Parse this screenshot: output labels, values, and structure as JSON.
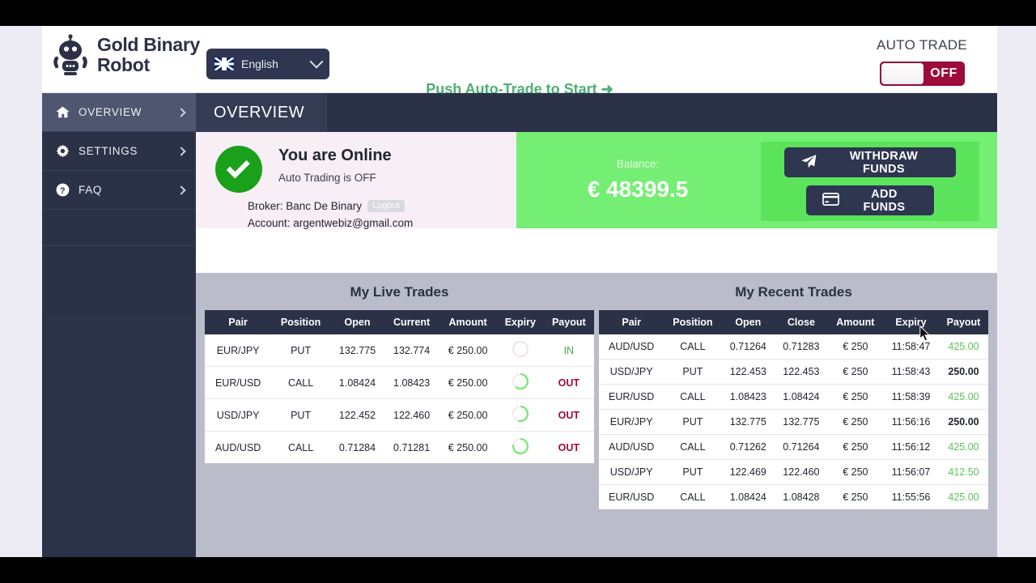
{
  "header": {
    "brand_name": "Gold Binary\nRobot",
    "logo_icon": "robot-icon",
    "language": {
      "flag_icon": "uk-flag-icon",
      "label": "English",
      "chevron_icon": "chevron-down-icon"
    },
    "cta": "Push Auto-Trade to Start ➜",
    "auto_trade": {
      "label": "AUTO TRADE",
      "state": "OFF"
    }
  },
  "sidebar": {
    "items": [
      {
        "label": "OVERVIEW",
        "icon": "home-icon",
        "arrow_icon": "chevron-right-icon",
        "active": true
      },
      {
        "label": "SETTINGS",
        "icon": "gear-icon",
        "arrow_icon": "chevron-right-icon",
        "active": false
      },
      {
        "label": "FAQ",
        "icon": "question-icon",
        "arrow_icon": "chevron-right-icon",
        "active": false
      }
    ]
  },
  "main": {
    "page_title": "OVERVIEW",
    "status_card": {
      "check_icon": "check-circle-icon",
      "title": "You are Online",
      "subtitle": "Auto Trading is OFF",
      "broker_label": "Broker: Banc De Binary",
      "logout_label": "Logout",
      "account_label": "Account: argentwebiz@gmail.com"
    },
    "balance_card": {
      "balance_label": "Balance:",
      "balance_value": "€ 48399.5",
      "withdraw_label": "WITHDRAW FUNDS",
      "withdraw_icon": "paper-plane-icon",
      "add_funds_label": "ADD FUNDS",
      "add_funds_icon": "credit-card-icon"
    }
  },
  "live_trades": {
    "title": "My Live Trades",
    "columns": [
      "Pair",
      "Position",
      "Open",
      "Current",
      "Amount",
      "Expiry",
      "Payout"
    ],
    "rows": [
      {
        "pair": "EUR/JPY",
        "position": "PUT",
        "open": "132.775",
        "current": "132.774",
        "amount": "€ 250.00",
        "progress": 0,
        "payout": "IN",
        "payout_kind": "in"
      },
      {
        "pair": "EUR/USD",
        "position": "CALL",
        "open": "1.08424",
        "current": "1.08423",
        "amount": "€ 250.00",
        "progress": 62,
        "payout": "OUT",
        "payout_kind": "out"
      },
      {
        "pair": "USD/JPY",
        "position": "PUT",
        "open": "122.452",
        "current": "122.460",
        "amount": "€ 250.00",
        "progress": 55,
        "payout": "OUT",
        "payout_kind": "out"
      },
      {
        "pair": "AUD/USD",
        "position": "CALL",
        "open": "0.71284",
        "current": "0.71281",
        "amount": "€ 250.00",
        "progress": 78,
        "payout": "OUT",
        "payout_kind": "out"
      }
    ]
  },
  "recent_trades": {
    "title": "My Recent Trades",
    "columns": [
      "Pair",
      "Position",
      "Open",
      "Close",
      "Amount",
      "Expiry",
      "Payout"
    ],
    "rows": [
      {
        "pair": "AUD/USD",
        "position": "CALL",
        "open": "0.71264",
        "close": "0.71283",
        "amount": "€ 250",
        "expiry": "11:58:47",
        "payout": "425.00",
        "payout_kind": "win"
      },
      {
        "pair": "USD/JPY",
        "position": "PUT",
        "open": "122.453",
        "close": "122.453",
        "amount": "€ 250",
        "expiry": "11:58:43",
        "payout": "250.00",
        "payout_kind": "tie"
      },
      {
        "pair": "EUR/USD",
        "position": "CALL",
        "open": "1.08423",
        "close": "1.08424",
        "amount": "€ 250",
        "expiry": "11:58:39",
        "payout": "425.00",
        "payout_kind": "win"
      },
      {
        "pair": "EUR/JPY",
        "position": "PUT",
        "open": "132.775",
        "close": "132.775",
        "amount": "€ 250",
        "expiry": "11:56:16",
        "payout": "250.00",
        "payout_kind": "tie"
      },
      {
        "pair": "AUD/USD",
        "position": "CALL",
        "open": "0.71262",
        "close": "0.71264",
        "amount": "€ 250",
        "expiry": "11:56:12",
        "payout": "425.00",
        "payout_kind": "win"
      },
      {
        "pair": "USD/JPY",
        "position": "PUT",
        "open": "122.469",
        "close": "122.460",
        "amount": "€ 250",
        "expiry": "11:56:07",
        "payout": "412.50",
        "payout_kind": "win"
      },
      {
        "pair": "EUR/USD",
        "position": "CALL",
        "open": "1.08424",
        "close": "1.08428",
        "amount": "€ 250",
        "expiry": "11:55:56",
        "payout": "425.00",
        "payout_kind": "win"
      }
    ]
  },
  "colors": {
    "navy": "#2b3247",
    "green_bright": "#74ef74",
    "green_text": "#4caf72",
    "maroon": "#9e0b3b",
    "table_bg": "#bbbcc9"
  }
}
